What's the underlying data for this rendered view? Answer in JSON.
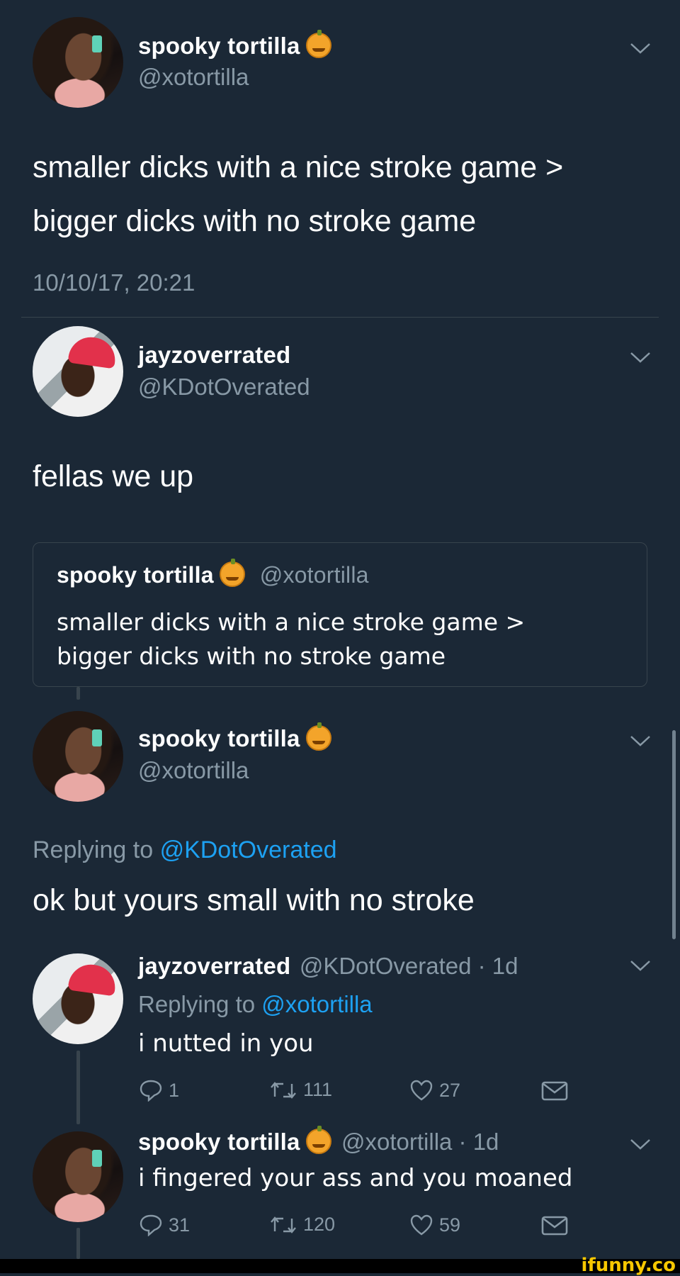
{
  "tweet1": {
    "name": "spooky tortilla",
    "handle": "@xotortilla",
    "text_line1": "smaller dicks with a nice stroke game >",
    "text_line2": "bigger dicks with no stroke game",
    "timestamp": "10/10/17, 20:21"
  },
  "tweet2": {
    "name": "jayzoverrated",
    "handle": "@KDotOverated",
    "text": "fellas we up",
    "quote": {
      "name": "spooky tortilla",
      "handle": "@xotortilla",
      "text_line1": "smaller dicks with a nice stroke game >",
      "text_line2": "bigger dicks with no stroke game"
    }
  },
  "tweet3": {
    "name": "spooky tortilla",
    "handle": "@xotortilla",
    "replying_prefix": "Replying to",
    "replying_handle": "@KDotOverated",
    "text": "ok but yours small with no stroke"
  },
  "tweet4": {
    "name": "jayzoverrated",
    "handle_time": "@KDotOverated · 1d",
    "replying_prefix": "Replying to",
    "replying_handle": "@xotortilla",
    "text": "i nutted in you",
    "replies": "1",
    "retweets": "111",
    "likes": "27"
  },
  "tweet5": {
    "name": "spooky tortilla",
    "handle_time": "@xotortilla · 1d",
    "text": "i fingered your ass and you moaned",
    "replies": "31",
    "retweets": "120",
    "likes": "59"
  },
  "watermark": "ifunny.co",
  "colors": {
    "background": "#1b2836",
    "secondary_text": "#8899a6",
    "link": "#1da1f2",
    "divider": "#38444d"
  },
  "icons": [
    "chevron-down-icon",
    "pumpkin-emoji-icon",
    "reply-icon",
    "retweet-icon",
    "like-icon",
    "message-icon"
  ]
}
